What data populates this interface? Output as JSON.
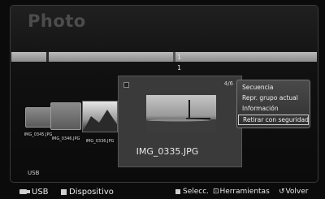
{
  "app": {
    "title": "Photo"
  },
  "pager": {
    "top": "1",
    "bottom": "1"
  },
  "thumbnails": [
    {
      "label": "IMG_0345.JPG"
    },
    {
      "label": "IMG_0346.JPG"
    },
    {
      "label": "IMG_0336.JPG"
    }
  ],
  "preview": {
    "count": "4/6",
    "filename": "IMG_0335.JPG"
  },
  "tools_menu": {
    "items": [
      {
        "label": "Secuencia"
      },
      {
        "label": "Repr. grupo actual"
      },
      {
        "label": "Información"
      },
      {
        "label": "Retirar con seguridad"
      }
    ],
    "selected_index": 3
  },
  "device_label": "USB",
  "footer": {
    "usb_label": "USB",
    "device_label": "Dispositivo",
    "select_label": "Selecc.",
    "tools_label": "Herramientas",
    "back_label": "Volver"
  }
}
